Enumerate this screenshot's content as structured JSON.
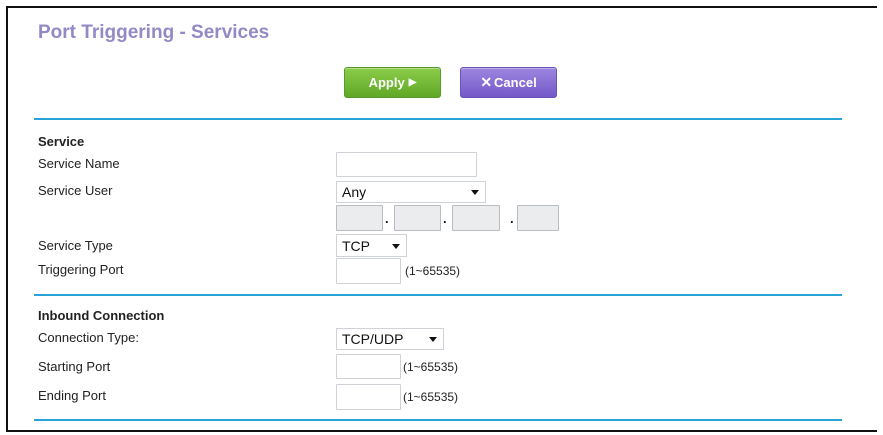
{
  "page": {
    "title": "Port Triggering - Services"
  },
  "toolbar": {
    "apply_label": "Apply",
    "apply_icon": "play-arrow-icon",
    "cancel_label": "Cancel",
    "cancel_icon": "x-icon"
  },
  "service": {
    "heading": "Service",
    "service_name_label": "Service Name",
    "service_name_value": "",
    "service_user_label": "Service User",
    "service_user_value": "Any",
    "ip_octets": [
      "",
      "",
      "",
      ""
    ],
    "ip_separator": ".",
    "service_type_label": "Service Type",
    "service_type_value": "TCP",
    "triggering_port_label": "Triggering Port",
    "triggering_port_value": "",
    "triggering_port_range": "(1~65535)"
  },
  "inbound": {
    "heading": "Inbound Connection",
    "connection_type_label": "Connection Type:",
    "connection_type_value": "TCP/UDP",
    "starting_port_label": "Starting Port",
    "starting_port_value": "",
    "starting_port_range": "(1~65535)",
    "ending_port_label": "Ending Port",
    "ending_port_value": "",
    "ending_port_range": "(1~65535)"
  },
  "colors": {
    "title": "#9489c4",
    "apply_button": "#6eb834",
    "cancel_button": "#8369d6",
    "section_rule": "#2aa3d8"
  }
}
